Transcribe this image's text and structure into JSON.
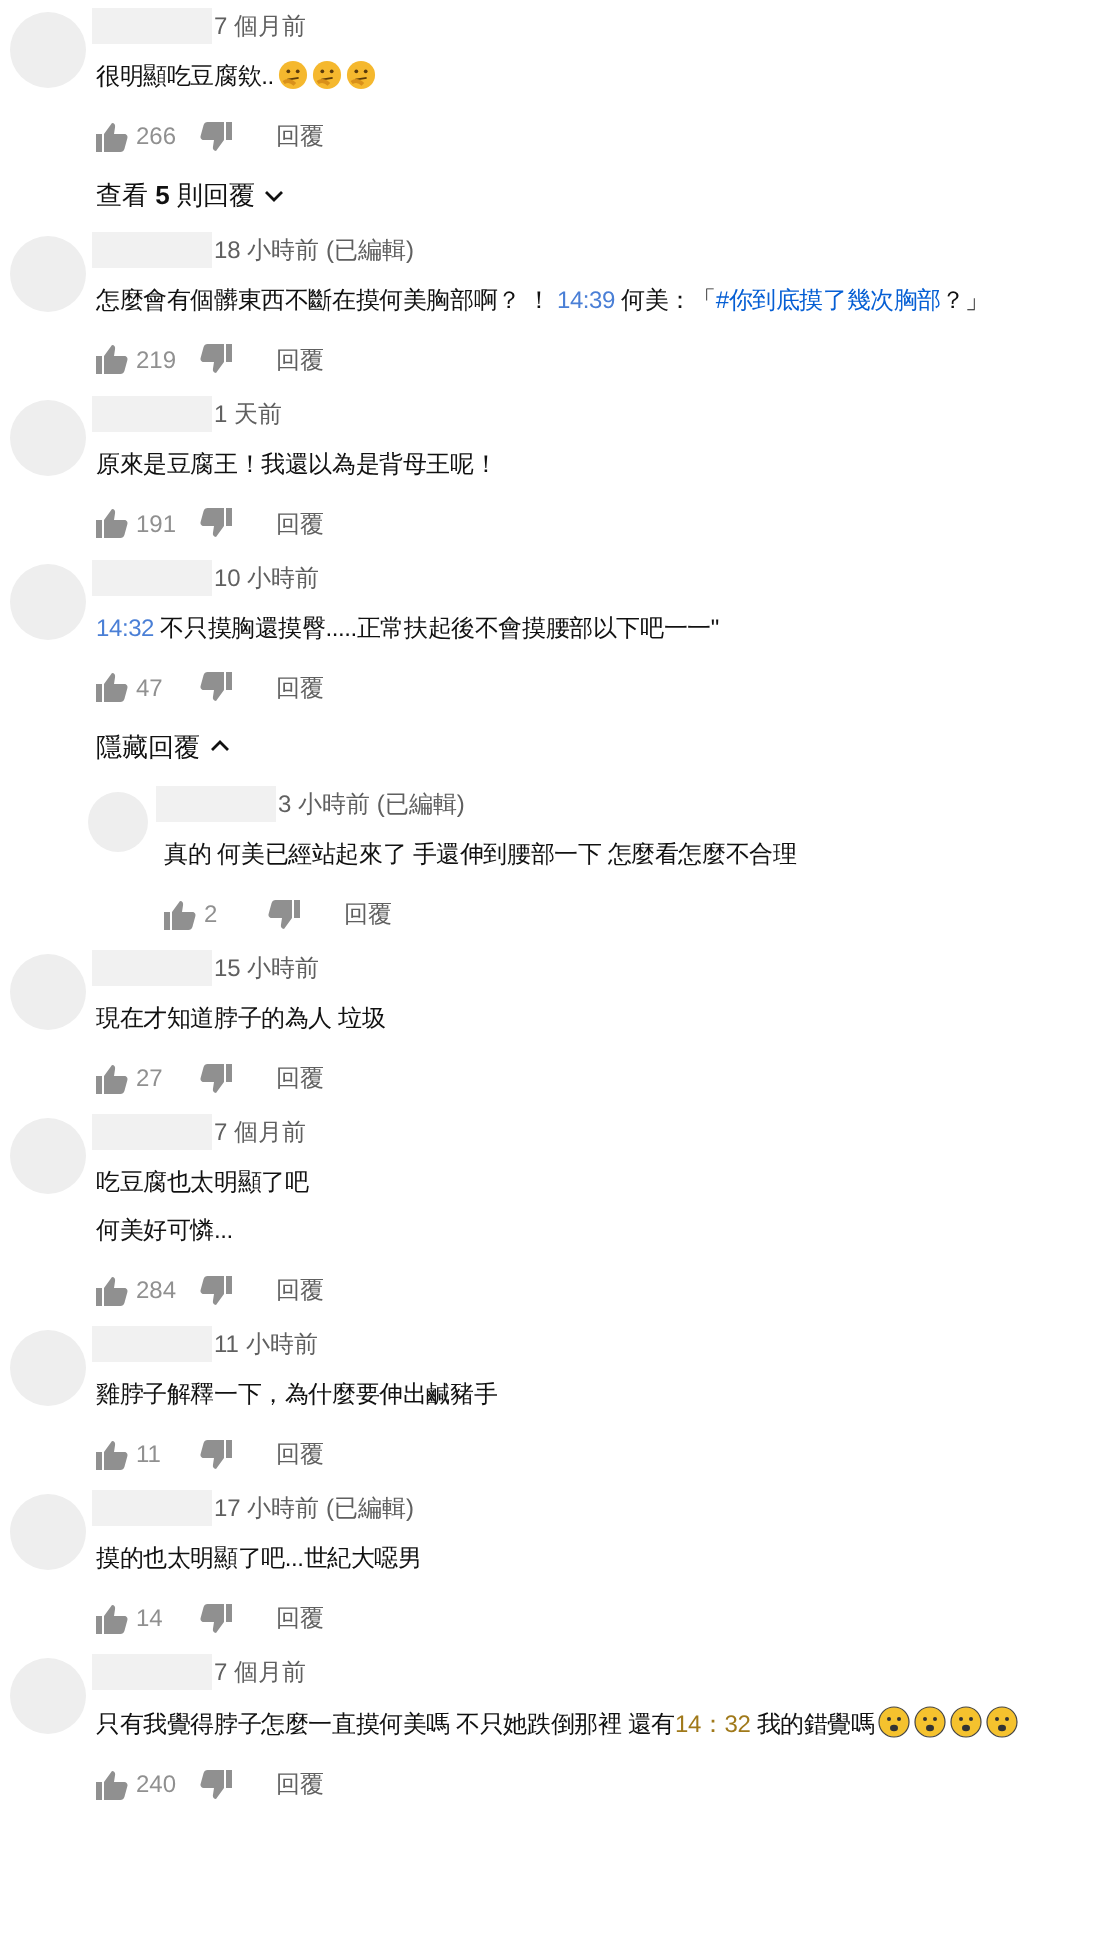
{
  "comments": [
    {
      "time": "7 個月前",
      "lines": [
        [
          {
            "kind": "plain",
            "text": "很明顯吃豆腐欸.."
          }
        ]
      ],
      "emojis": [
        {
          "kind": "thinking"
        },
        {
          "kind": "thinking"
        },
        {
          "kind": "thinking"
        }
      ],
      "likes": "266",
      "reply": "回覆",
      "toggle": {
        "label": "查看 **5** 則回覆",
        "expanded": false
      }
    },
    {
      "time": "18 小時前 (已編輯)",
      "lines": [
        [
          {
            "kind": "plain",
            "text": "怎麼會有個髒東西不斷在摸何美胸部啊？ ！ "
          },
          {
            "kind": "link",
            "text": "14:39"
          },
          {
            "kind": "plain",
            "text": " 何美：「"
          },
          {
            "kind": "hashtag",
            "text": "#你到底摸了幾次胸部"
          },
          {
            "kind": "plain",
            "text": "？」"
          }
        ]
      ],
      "likes": "219",
      "reply": "回覆"
    },
    {
      "time": "1 天前",
      "lines": [
        [
          {
            "kind": "plain",
            "text": "原來是豆腐王！我還以為是背母王呢！"
          }
        ]
      ],
      "likes": "191",
      "reply": "回覆"
    },
    {
      "time": "10 小時前",
      "lines": [
        [
          {
            "kind": "link",
            "text": "14:32"
          },
          {
            "kind": "plain",
            "text": " 不只摸胸還摸臀.....正常扶起後不會摸腰部以下吧一一\""
          }
        ]
      ],
      "likes": "47",
      "reply": "回覆",
      "toggle": {
        "label": "隱藏回覆",
        "expanded": true
      },
      "children": [
        {
          "time": "3 小時前 (已編輯)",
          "lines": [
            [
              {
                "kind": "plain",
                "text": "真的 何美已經站起來了 手還伸到腰部一下 怎麼看怎麼不合理"
              }
            ]
          ],
          "likes": "2",
          "reply": "回覆"
        }
      ]
    },
    {
      "time": "15 小時前",
      "lines": [
        [
          {
            "kind": "plain",
            "text": "現在才知道脖子的為人 垃圾"
          }
        ]
      ],
      "likes": "27",
      "reply": "回覆"
    },
    {
      "time": "7 個月前",
      "lines": [
        [
          {
            "kind": "plain",
            "text": "吃豆腐也太明顯了吧"
          }
        ],
        [
          {
            "kind": "plain",
            "text": "何美好可憐..."
          }
        ]
      ],
      "likes": "284",
      "reply": "回覆"
    },
    {
      "time": "11 小時前",
      "lines": [
        [
          {
            "kind": "plain",
            "text": "雞脖子解釋一下，為什麼要伸出鹹豬手"
          }
        ]
      ],
      "likes": "11",
      "reply": "回覆"
    },
    {
      "time": "17 小時前 (已編輯)",
      "lines": [
        [
          {
            "kind": "plain",
            "text": "摸的也太明顯了吧...世紀大噁男"
          }
        ]
      ],
      "likes": "14",
      "reply": "回覆"
    },
    {
      "time": "7 個月前",
      "lines": [
        [
          {
            "kind": "plain",
            "text": "只有我覺得脖子怎麼一直摸何美嗎 不只她跌倒那裡 還有"
          },
          {
            "kind": "tinted",
            "text": "14：32"
          },
          {
            "kind": "plain",
            "text": " 我的錯覺嗎"
          }
        ]
      ],
      "emojis": [
        {
          "kind": "frowning"
        },
        {
          "kind": "frowning"
        },
        {
          "kind": "frowning"
        },
        {
          "kind": "frowning"
        }
      ],
      "likes": "240",
      "reply": "回覆"
    }
  ]
}
